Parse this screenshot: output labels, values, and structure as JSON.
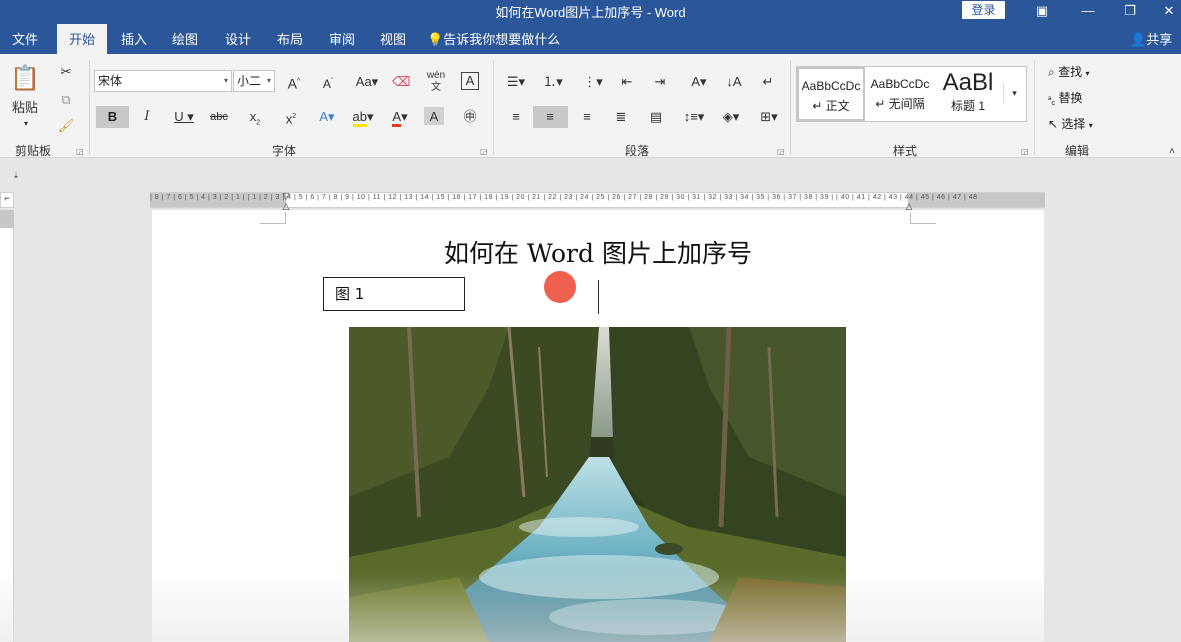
{
  "window": {
    "title": "如何在Word图片上加序号  -  Word",
    "login_label": "登录",
    "controls": [
      "ribbon-display",
      "minimize",
      "restore",
      "close"
    ]
  },
  "menu": {
    "tabs": [
      "文件",
      "开始",
      "插入",
      "绘图",
      "设计",
      "布局",
      "审阅",
      "视图"
    ],
    "active_tab": "开始",
    "tell_me": "告诉我你想要做什么",
    "share": "共享"
  },
  "ribbon": {
    "clipboard": {
      "paste_label": "粘贴",
      "group_label": "剪贴板"
    },
    "font": {
      "font_name": "宋体",
      "font_size": "小二",
      "group_label": "字体"
    },
    "paragraph": {
      "group_label": "段落"
    },
    "styles": {
      "group_label": "样式",
      "items": [
        {
          "sample": "AaBbCcDc",
          "name": "↵ 正文"
        },
        {
          "sample": "AaBbCcDc",
          "name": "↵ 无间隔"
        },
        {
          "sample": "AaBl",
          "name": "标题 1"
        }
      ]
    },
    "editing": {
      "group_label": "编辑",
      "find": "查找",
      "replace": "替换",
      "select": "选择"
    }
  },
  "ruler": {
    "numbers": "| 8 | 7 | 6 | 5 | 4 | 3 | 2 | 1 |   | 1 | 2 | 3 | 4 | 5 | 6 | 7 | 8 | 9 | 10 | 11 | 12 | 13 | 14 | 15 | 16 | 17 | 18 | 19 | 20 | 21 | 22 | 23 | 24 | 25 | 26 | 27 | 28 | 29 | 30 | 31 | 32 | 33 | 34 | 35 | 36 | 37 | 38 | 39 |   | 40 | 41 | 42 | 43 | 44 | 45 | 46 | 47 | 48"
  },
  "document": {
    "title": "如何在 Word 图片上加序号",
    "textbox": "图 1",
    "image": "forest-river-photo"
  },
  "colors": {
    "brand": "#2b579a",
    "ribbon_bg": "#f3f3f3",
    "cursor_highlight": "#f0604f"
  }
}
